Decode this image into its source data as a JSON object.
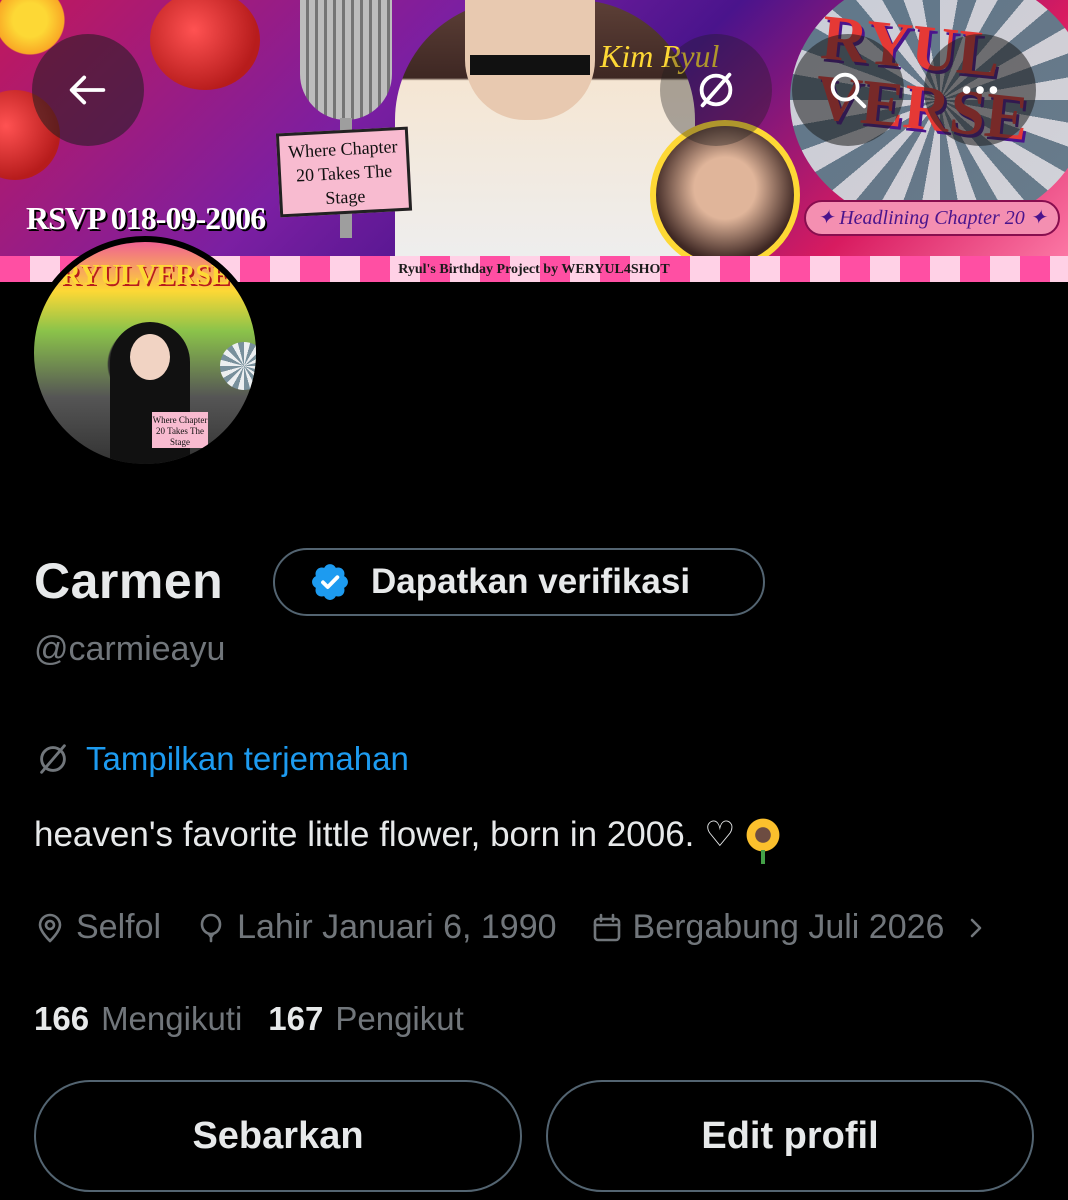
{
  "banner": {
    "rsvp": "RSVP 018-09-2006",
    "sign_text": "Where Chapter 20 Takes The Stage",
    "artist": "Kim Ryul",
    "logo": "RYUL VERSE",
    "headline": "✦ Headlining Chapter 20 ✦",
    "credit": "Ryul's Birthday Project by WERYUL4SHOT"
  },
  "nav": {
    "back_icon": "arrow-left-icon",
    "translate_icon": "translate-icon",
    "search_icon": "search-icon",
    "more_icon": "more-horizontal-icon"
  },
  "avatar": {
    "title": "RYULVERSE",
    "sign_text": "Where Chapter 20 Takes The Stage"
  },
  "profile": {
    "name": "Carmen",
    "verify_label": "Dapatkan verifikasi",
    "handle": "@carmieayu",
    "translate_label": "Tampilkan terjemahan",
    "bio": "heaven's favorite little flower, born in 2006. ♡",
    "location": "Selfol",
    "birthday": "Lahir Januari 6, 1990",
    "joined": "Bergabung Juli 2026"
  },
  "stats": {
    "following_count": "166",
    "following_label": "Mengikuti",
    "followers_count": "167",
    "followers_label": "Pengikut"
  },
  "actions": {
    "share_label": "Sebarkan",
    "edit_label": "Edit profil"
  },
  "colors": {
    "background": "#000000",
    "accent": "#1d9bf0",
    "muted_text": "#71767b",
    "border": "#536471"
  }
}
